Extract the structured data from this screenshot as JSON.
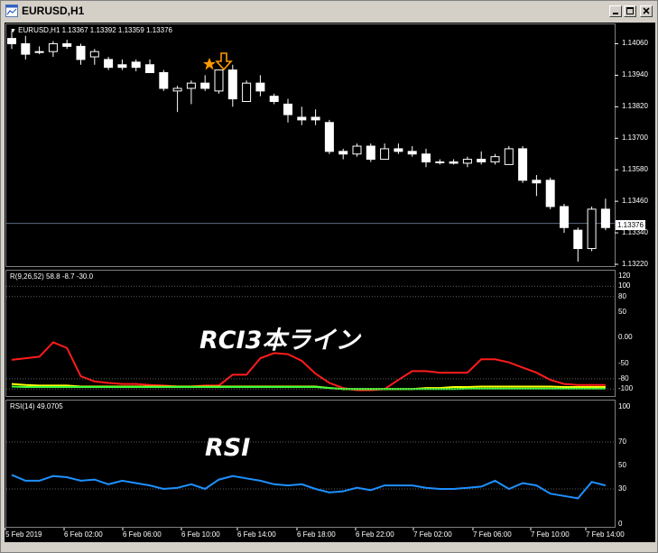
{
  "window": {
    "title": "EURUSD,H1"
  },
  "main_panel": {
    "info": "EURUSD,H1  1.13367 1.13392 1.13359 1.13376",
    "price_ticks": [
      "1.14060",
      "1.13940",
      "1.13820",
      "1.13700",
      "1.13580",
      "1.13460",
      "1.13340",
      "1.13220"
    ],
    "current_price": "1.13376",
    "annotations": {
      "star": "star",
      "arrow": "down-arrow"
    }
  },
  "rci_panel": {
    "info": "R(9,26,52) 58.8 -8.7 -30.0",
    "label": "RCI3本ライン",
    "ticks": [
      "120",
      "100",
      "80",
      "50",
      "0.00",
      "-50",
      "-80",
      "-100"
    ]
  },
  "rsi_panel": {
    "info": "RSI(14) 49.0705",
    "label": "RSI",
    "ticks": [
      "100",
      "70",
      "50",
      "30",
      "0"
    ]
  },
  "time_axis": [
    "5 Feb 2019",
    "6 Feb 02:00",
    "6 Feb 06:00",
    "6 Feb 10:00",
    "6 Feb 14:00",
    "6 Feb 18:00",
    "6 Feb 22:00",
    "7 Feb 02:00",
    "7 Feb 06:00",
    "7 Feb 10:00",
    "7 Feb 14:00"
  ],
  "colors": {
    "background": "#000000",
    "bull_candle": "#000000",
    "bear_candle": "#ffffff",
    "rci_short": "#ff1c1c",
    "rci_mid": "#ffff00",
    "rci_long": "#3cff3c",
    "rsi_line": "#1e90ff",
    "annotation": "#ff9900"
  },
  "chart_data": [
    {
      "type": "candlestick",
      "symbol": "EURUSD",
      "timeframe": "H1",
      "ylim": [
        1.1322,
        1.1412
      ],
      "candles": [
        {
          "o": 1.1408,
          "h": 1.1411,
          "l": 1.1404,
          "c": 1.1406
        },
        {
          "o": 1.1406,
          "h": 1.1409,
          "l": 1.14,
          "c": 1.1402
        },
        {
          "o": 1.1403,
          "h": 1.1405,
          "l": 1.1402,
          "c": 1.1403
        },
        {
          "o": 1.1403,
          "h": 1.1407,
          "l": 1.1401,
          "c": 1.1406
        },
        {
          "o": 1.1406,
          "h": 1.14075,
          "l": 1.1404,
          "c": 1.1405
        },
        {
          "o": 1.1405,
          "h": 1.1406,
          "l": 1.1398,
          "c": 1.14
        },
        {
          "o": 1.1401,
          "h": 1.1404,
          "l": 1.1398,
          "c": 1.1403
        },
        {
          "o": 1.14,
          "h": 1.1401,
          "l": 1.1396,
          "c": 1.1397
        },
        {
          "o": 1.1398,
          "h": 1.14,
          "l": 1.1396,
          "c": 1.1397
        },
        {
          "o": 1.1399,
          "h": 1.14,
          "l": 1.13955,
          "c": 1.1397
        },
        {
          "o": 1.1398,
          "h": 1.14,
          "l": 1.1395,
          "c": 1.1395
        },
        {
          "o": 1.1395,
          "h": 1.1396,
          "l": 1.1388,
          "c": 1.1389
        },
        {
          "o": 1.1388,
          "h": 1.139,
          "l": 1.138,
          "c": 1.1389
        },
        {
          "o": 1.1389,
          "h": 1.1392,
          "l": 1.1383,
          "c": 1.1391
        },
        {
          "o": 1.1391,
          "h": 1.1394,
          "l": 1.1388,
          "c": 1.1389
        },
        {
          "o": 1.1388,
          "h": 1.1396,
          "l": 1.1387,
          "c": 1.1396
        },
        {
          "o": 1.1396,
          "h": 1.1398,
          "l": 1.1382,
          "c": 1.1385
        },
        {
          "o": 1.1384,
          "h": 1.1392,
          "l": 1.1384,
          "c": 1.1391
        },
        {
          "o": 1.1391,
          "h": 1.1394,
          "l": 1.1386,
          "c": 1.1388
        },
        {
          "o": 1.1386,
          "h": 1.1387,
          "l": 1.1383,
          "c": 1.1384
        },
        {
          "o": 1.1383,
          "h": 1.1385,
          "l": 1.1376,
          "c": 1.1379
        },
        {
          "o": 1.1378,
          "h": 1.1382,
          "l": 1.1375,
          "c": 1.1377
        },
        {
          "o": 1.1378,
          "h": 1.1381,
          "l": 1.1375,
          "c": 1.1377
        },
        {
          "o": 1.1376,
          "h": 1.1377,
          "l": 1.1364,
          "c": 1.1365
        },
        {
          "o": 1.1365,
          "h": 1.1366,
          "l": 1.1362,
          "c": 1.1364
        },
        {
          "o": 1.1364,
          "h": 1.1368,
          "l": 1.1363,
          "c": 1.1367
        },
        {
          "o": 1.1367,
          "h": 1.1368,
          "l": 1.1361,
          "c": 1.1362
        },
        {
          "o": 1.1362,
          "h": 1.1368,
          "l": 1.1362,
          "c": 1.1366
        },
        {
          "o": 1.1366,
          "h": 1.1368,
          "l": 1.1364,
          "c": 1.1365
        },
        {
          "o": 1.1365,
          "h": 1.1367,
          "l": 1.1363,
          "c": 1.1364
        },
        {
          "o": 1.1364,
          "h": 1.1366,
          "l": 1.1359,
          "c": 1.1361
        },
        {
          "o": 1.1361,
          "h": 1.1362,
          "l": 1.136,
          "c": 1.1361
        },
        {
          "o": 1.1361,
          "h": 1.1362,
          "l": 1.136,
          "c": 1.13605
        },
        {
          "o": 1.13605,
          "h": 1.1363,
          "l": 1.1359,
          "c": 1.1362
        },
        {
          "o": 1.1362,
          "h": 1.1365,
          "l": 1.136,
          "c": 1.1361
        },
        {
          "o": 1.1361,
          "h": 1.1364,
          "l": 1.136,
          "c": 1.1363
        },
        {
          "o": 1.136,
          "h": 1.1367,
          "l": 1.136,
          "c": 1.1366
        },
        {
          "o": 1.1366,
          "h": 1.1367,
          "l": 1.1353,
          "c": 1.1354
        },
        {
          "o": 1.1354,
          "h": 1.1356,
          "l": 1.1348,
          "c": 1.1353
        },
        {
          "o": 1.1354,
          "h": 1.1355,
          "l": 1.1343,
          "c": 1.1344
        },
        {
          "o": 1.1344,
          "h": 1.1345,
          "l": 1.1334,
          "c": 1.1336
        },
        {
          "o": 1.1335,
          "h": 1.1336,
          "l": 1.1323,
          "c": 1.1328
        },
        {
          "o": 1.1328,
          "h": 1.1344,
          "l": 1.1327,
          "c": 1.1343
        },
        {
          "o": 1.1343,
          "h": 1.1347,
          "l": 1.1335,
          "c": 1.1336
        }
      ],
      "current_price": 1.13376
    },
    {
      "type": "line",
      "name": "RCI",
      "ylim": [
        -110,
        120
      ],
      "series": [
        {
          "values": [
            -43,
            -40,
            -37,
            -9,
            -20,
            -75,
            -85,
            -88,
            -90,
            -90,
            -92,
            -93,
            -95,
            -95,
            -93,
            -93,
            -72,
            -72,
            -40,
            -30,
            -32,
            -45,
            -70,
            -88,
            -98,
            -102,
            -102,
            -100,
            -82,
            -65,
            -65,
            -68,
            -68,
            -68,
            -42,
            -42,
            -48,
            -58,
            -68,
            -82,
            -90,
            -92,
            -92,
            -92
          ]
        },
        {
          "values": [
            -90,
            -92,
            -93,
            -93,
            -93,
            -95,
            -95,
            -95,
            -95,
            -95,
            -95,
            -95,
            -95,
            -95,
            -95,
            -95,
            -95,
            -95,
            -95,
            -95,
            -95,
            -95,
            -95,
            -98,
            -100,
            -100,
            -100,
            -100,
            -100,
            -100,
            -98,
            -98,
            -96,
            -96,
            -95,
            -95,
            -95,
            -95,
            -95,
            -95,
            -96,
            -96,
            -96,
            -96
          ]
        },
        {
          "values": [
            -95,
            -96,
            -96,
            -96,
            -96,
            -96,
            -96,
            -96,
            -96,
            -96,
            -96,
            -96,
            -96,
            -96,
            -96,
            -96,
            -96,
            -96,
            -96,
            -96,
            -96,
            -96,
            -96,
            -98,
            -100,
            -100,
            -100,
            -100,
            -100,
            -100,
            -100,
            -100,
            -100,
            -99,
            -99,
            -99,
            -99,
            -99,
            -99,
            -99,
            -99,
            -99,
            -99,
            -99
          ]
        }
      ]
    },
    {
      "type": "line",
      "name": "RSI(14)",
      "ylim": [
        0,
        100
      ],
      "series": [
        {
          "values": [
            42,
            37,
            37,
            41,
            40,
            37,
            38,
            34,
            37,
            35,
            33,
            30,
            31,
            34,
            30,
            38,
            41,
            39,
            37,
            34,
            33,
            34,
            30,
            27,
            28,
            31,
            29,
            33,
            33,
            33,
            31,
            30,
            30,
            31,
            32,
            37,
            30,
            35,
            33,
            26,
            24,
            22,
            36,
            33
          ]
        }
      ]
    }
  ]
}
